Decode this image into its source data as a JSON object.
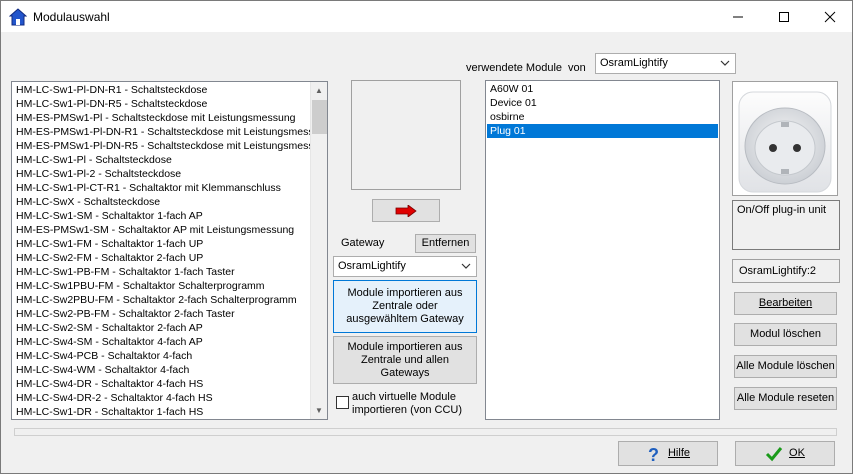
{
  "window": {
    "title": "Modulauswahl"
  },
  "module_list": {
    "items": [
      "HM-LC-Sw1-Pl-DN-R1 - Schaltsteckdose",
      "HM-LC-Sw1-Pl-DN-R5 - Schaltsteckdose",
      "HM-ES-PMSw1-Pl - Schaltsteckdose mit Leistungsmessung",
      "HM-ES-PMSw1-Pl-DN-R1 - Schaltsteckdose mit Leistungsmess",
      "HM-ES-PMSw1-Pl-DN-R5 - Schaltsteckdose mit Leistungsmess",
      "HM-LC-Sw1-Pl - Schaltsteckdose",
      "HM-LC-Sw1-Pl-2 - Schaltsteckdose",
      "HM-LC-Sw1-Pl-CT-R1 - Schaltaktor mit Klemmanschluss",
      "HM-LC-SwX - Schaltsteckdose",
      "HM-LC-Sw1-SM - Schaltaktor 1-fach AP",
      "HM-ES-PMSw1-SM - Schaltaktor AP mit Leistungsmessung",
      "HM-LC-Sw1-FM - Schaltaktor 1-fach UP",
      "HM-LC-Sw2-FM - Schaltaktor 2-fach UP",
      "HM-LC-Sw1-PB-FM - Schaltaktor 1-fach Taster",
      "HM-LC-Sw1PBU-FM - Schaltaktor Schalterprogramm",
      "HM-LC-Sw2PBU-FM - Schaltaktor 2-fach Schalterprogramm",
      "HM-LC-Sw2-PB-FM - Schaltaktor 2-fach Taster",
      "HM-LC-Sw2-SM - Schaltaktor 2-fach AP",
      "HM-LC-Sw4-SM - Schaltaktor 4-fach AP",
      "HM-LC-Sw4-PCB - Schaltaktor 4-fach",
      "HM-LC-Sw4-WM - Schaltaktor 4-fach",
      "HM-LC-Sw4-DR - Schaltaktor 4-fach HS",
      "HM-LC-Sw4-DR-2 - Schaltaktor 4-fach HS",
      "HM-LC-Sw1-DR - Schaltaktor 1-fach HS"
    ]
  },
  "gateway": {
    "label": "Gateway",
    "remove_button": "Entfernen",
    "selected": "OsramLightify",
    "import_selected_button": "Module importieren aus Zentrale oder ausgewähltem Gateway",
    "import_all_button": "Module importieren aus Zentrale und allen Gateways",
    "virtual_checkbox_label": "auch virtuelle Module importieren (von CCU)",
    "virtual_checkbox_checked": false
  },
  "used_modules": {
    "label": "verwendete Module",
    "from_label": "von",
    "source_selected": "OsramLightify",
    "items": [
      "A60W 01",
      "Device 01",
      "osbirne",
      "Plug 01"
    ],
    "selected_index": 3
  },
  "details": {
    "description": "On/Off plug-in unit",
    "instance": "OsramLightify:2"
  },
  "actions": {
    "edit": "Bearbeiten",
    "delete_module": "Modul löschen",
    "delete_all": "Alle Module löschen",
    "reset_all": "Alle Module reseten",
    "help": "Hilfe",
    "ok": "OK"
  },
  "colors": {
    "selection": "#0078d7",
    "accent_button_border": "#0078d7",
    "ok_check": "#1a9a1a",
    "arrow_red": "#e00000"
  }
}
